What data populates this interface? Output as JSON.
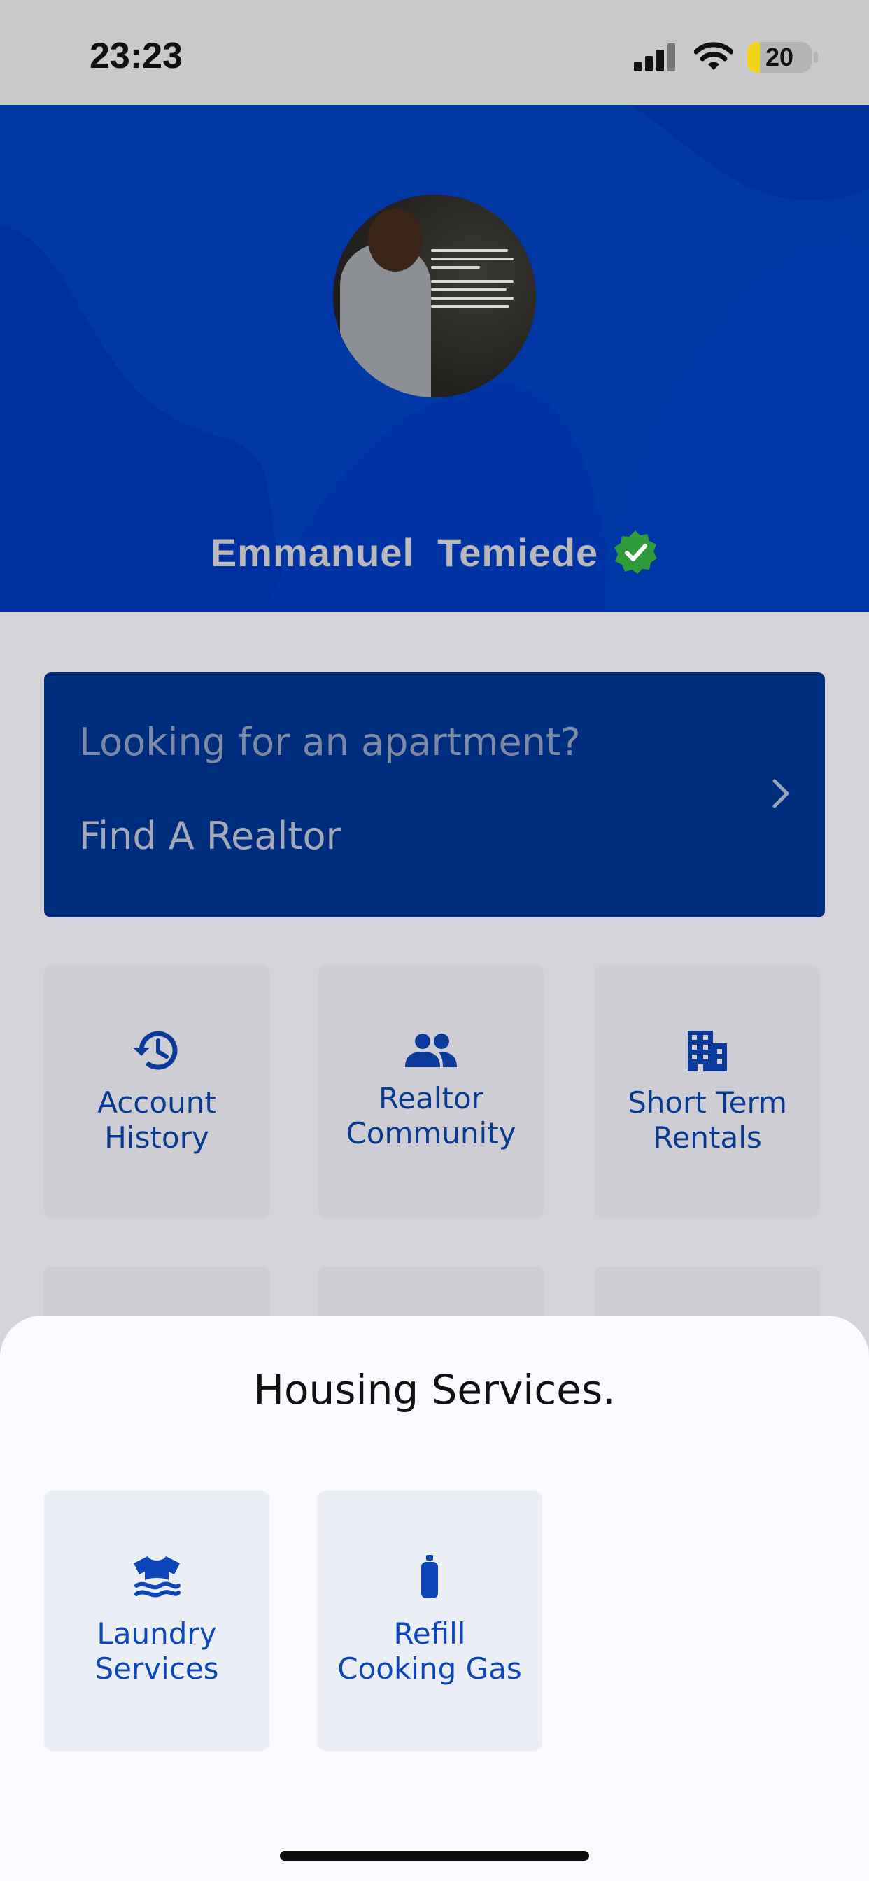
{
  "status_bar": {
    "time": "23:23",
    "battery": "20",
    "battery_level": 0.2
  },
  "profile": {
    "name": "Emmanuel  Temiede",
    "verified_icon": "verified-badge-icon"
  },
  "promo": {
    "question": "Looking for an apartment?",
    "cta": "Find A Realtor",
    "icon": "chevron-right-icon"
  },
  "grid": {
    "items": [
      {
        "label": "Account\nHistory",
        "icon": "history-icon"
      },
      {
        "label": "Realtor\nCommunity",
        "icon": "group-icon"
      },
      {
        "label": "Short Term\nRentals",
        "icon": "building-icon"
      }
    ]
  },
  "sheet": {
    "title": "Housing Services.",
    "services": [
      {
        "label": "Laundry\nServices",
        "icon": "laundry-shirt-icon"
      },
      {
        "label": "Refill\nCooking Gas",
        "icon": "gas-bottle-icon"
      }
    ]
  },
  "colors": {
    "accent": "#0138a6",
    "verified": "#2f9a3a",
    "icon_blue": "#0d46b8"
  }
}
